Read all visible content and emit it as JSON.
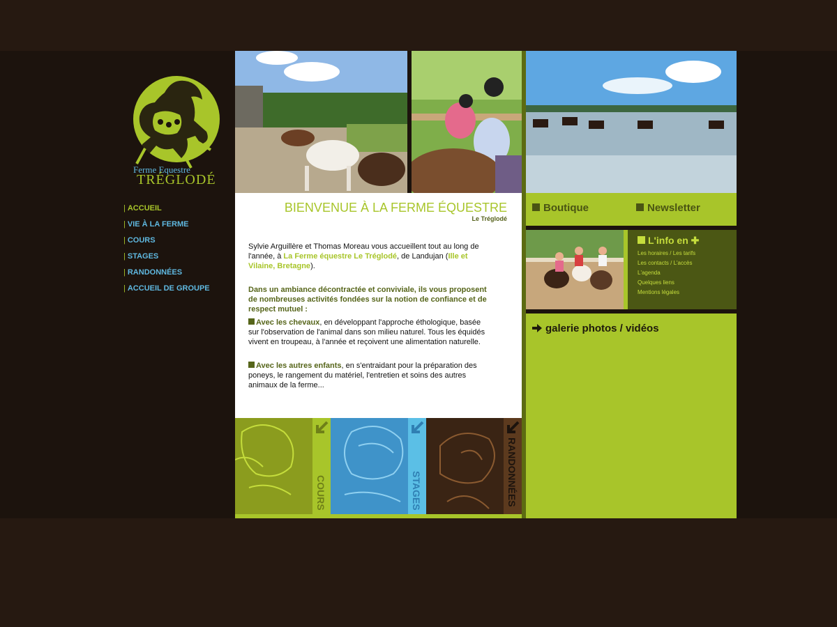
{
  "brand": {
    "line1": "Ferme Equestre",
    "line2": "TRÉGLODÉ"
  },
  "nav": [
    {
      "label": "ACCUEIL",
      "active": true
    },
    {
      "label": "VIE À LA FERME",
      "active": false
    },
    {
      "label": "COURS",
      "active": false
    },
    {
      "label": "STAGES",
      "active": false
    },
    {
      "label": "RANDONNÉES",
      "active": false
    },
    {
      "label": "ACCUEIL DE GROUPE",
      "active": false
    }
  ],
  "nav_separator": "|",
  "main": {
    "title": "BIENVENUE À LA FERME ÉQUESTRE",
    "subtitle": "Le Tréglodé",
    "intro_a": "Sylvie Arguillère et Thomas Moreau vous accueillent tout au long de l'année, à ",
    "intro_link1": "La Ferme équestre Le Tréglodé",
    "intro_b": ", de Landujan (",
    "intro_link2": "Ille et Vilaine, Bretagne",
    "intro_c": ").",
    "lead": "Dans un ambiance décontractée et conviviale, ils vous proposent de nombreuses activités fondées sur la notion de confiance et de respect mutuel :",
    "item1_title": "Avec les chevaux",
    "item1_text": ", en développant l'approche éthologique, basée sur l'observation de l'animal dans son milieu naturel. Tous les équidés vivent en troupeau, à l'année et reçoivent une alimentation naturelle.",
    "item2_title": "Avec les autres enfants",
    "item2_text": ", en s'entraidant pour la préparation des poneys, le rangement du matériel, l'entretien et soins des autres animaux de la ferme..."
  },
  "tiles": [
    {
      "label": "COURS",
      "color": "#8b9c1e"
    },
    {
      "label": "STAGES",
      "color": "#3f93c9"
    },
    {
      "label": "RANDONNÉES",
      "color": "#3a2414"
    }
  ],
  "sidebar_right": {
    "boutique": "Boutique",
    "newsletter": "Newsletter",
    "info_title": "L'info en",
    "info_links": [
      "Les horaires / Les tarifs",
      "Les contacts / L'accès",
      "L'agenda",
      "Quelques liens",
      "Mentions légales"
    ],
    "gallery": "galerie photos / vidéos"
  },
  "colors": {
    "background": "#261911",
    "lime": "#a8c52a",
    "olive": "#4b5714",
    "blue": "#5fb8e0",
    "brown": "#3a2414"
  }
}
